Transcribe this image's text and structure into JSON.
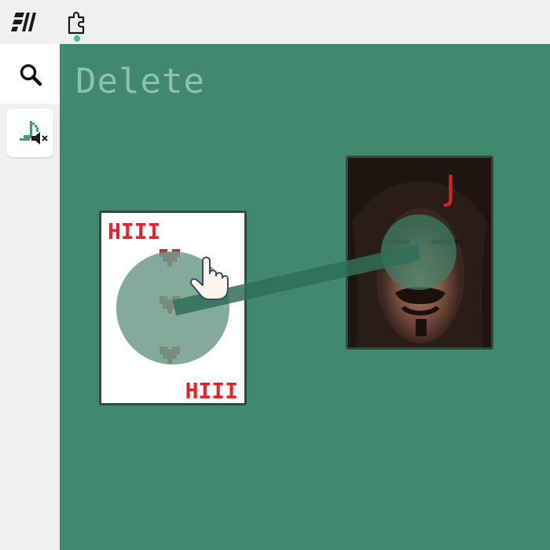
{
  "toolbar": {
    "logo_icon": "app-logo-icon",
    "extensions_icon": "puzzle-piece-icon"
  },
  "sidebar": {
    "search_icon": "search-icon",
    "sound_icon": "music-note-muted-icon"
  },
  "board": {
    "delete_label": "Delete",
    "background_color": "#40896f"
  },
  "cards": [
    {
      "name": "three-of-hearts",
      "rank_text": "HIII",
      "suit": "hearts",
      "pips": 3
    },
    {
      "name": "jack",
      "rank_text": "J"
    }
  ],
  "cursor_icon": "pointing-hand-icon"
}
